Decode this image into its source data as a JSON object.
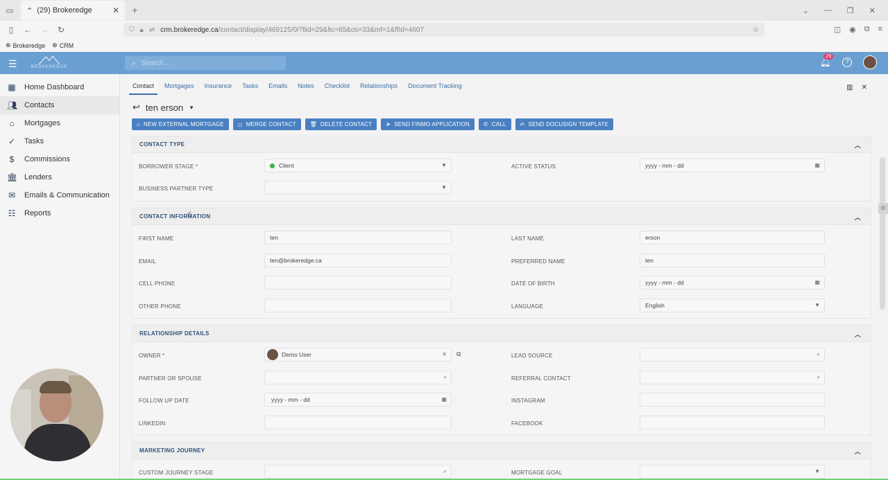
{
  "browser": {
    "tab_title": "(29) Brokeredge",
    "url_host": "crm.brokeredge.ca",
    "url_path": "/contact/display/469125/0/?llid=29&ltc=65&os=33&mf=1&ffId=4607",
    "bookmarks": [
      "Brokeredge",
      "CRM"
    ]
  },
  "header": {
    "logo_text": "BROKEREDGE",
    "search_placeholder": "Search...",
    "notification_count": "29"
  },
  "sidebar": {
    "items": [
      {
        "label": "Home Dashboard",
        "icon": "dashboard-icon"
      },
      {
        "label": "Contacts",
        "icon": "people-icon"
      },
      {
        "label": "Mortgages",
        "icon": "house-icon"
      },
      {
        "label": "Tasks",
        "icon": "check-circle-icon"
      },
      {
        "label": "Commissions",
        "icon": "dollar-icon"
      },
      {
        "label": "Lenders",
        "icon": "bank-icon"
      },
      {
        "label": "Emails & Communication",
        "icon": "envelope-icon"
      },
      {
        "label": "Reports",
        "icon": "list-icon"
      }
    ],
    "active": "Contacts"
  },
  "content_tabs": [
    "Contact",
    "Mortgages",
    "Insurance",
    "Tasks",
    "Emails",
    "Notes",
    "Checklist",
    "Relationships",
    "Document Tracking"
  ],
  "contact": {
    "name": "ten erson"
  },
  "action_buttons": [
    "NEW EXTERNAL MORTGAGE",
    "MERGE CONTACT",
    "DELETE CONTACT",
    "SEND FINMO APPLICATION",
    "CALL",
    "SEND DOCUSIGN TEMPLATE"
  ],
  "sections": {
    "contact_type": {
      "title": "CONTACT TYPE",
      "borrower_stage_label": "BORROWER STAGE",
      "borrower_stage_value": "Client",
      "active_status_label": "ACTIVE STATUS",
      "active_status_placeholder": "yyyy - mm - dd",
      "business_partner_type_label": "BUSINESS PARTNER TYPE"
    },
    "contact_information": {
      "title": "CONTACT INFORMATION",
      "first_name_label": "FIRST NAME",
      "first_name_value": "ten",
      "last_name_label": "LAST NAME",
      "last_name_value": "erson",
      "email_label": "EMAIL",
      "email_value": "ten@brokeredge.ca",
      "preferred_name_label": "PREFERRED NAME",
      "preferred_name_value": "ten",
      "cell_phone_label": "CELL PHONE",
      "date_of_birth_label": "DATE OF BIRTH",
      "date_of_birth_placeholder": "yyyy - mm - dd",
      "other_phone_label": "OTHER PHONE",
      "language_label": "LANGUAGE",
      "language_value": "English"
    },
    "relationship_details": {
      "title": "RELATIONSHIP DETAILS",
      "owner_label": "OWNER",
      "owner_value": "Demo User",
      "lead_source_label": "LEAD SOURCE",
      "partner_label": "PARTNER OR SPOUSE",
      "referral_label": "REFERRAL CONTACT",
      "follow_up_label": "FOLLOW UP DATE",
      "follow_up_placeholder": "yyyy - mm - dd",
      "instagram_label": "INSTAGRAM",
      "linkedin_label": "LINKEDIN",
      "facebook_label": "FACEBOOK"
    },
    "marketing_journey": {
      "title": "MARKETING JOURNEY",
      "custom_journey_label": "CUSTOM JOURNEY STAGE",
      "mortgage_goal_label": "MORTGAGE GOAL"
    }
  },
  "colors": {
    "header_blue": "#6a9fd1",
    "button_blue": "#4a80c2",
    "link_blue": "#3a6ea8",
    "client_status_green": "#3db34a"
  }
}
